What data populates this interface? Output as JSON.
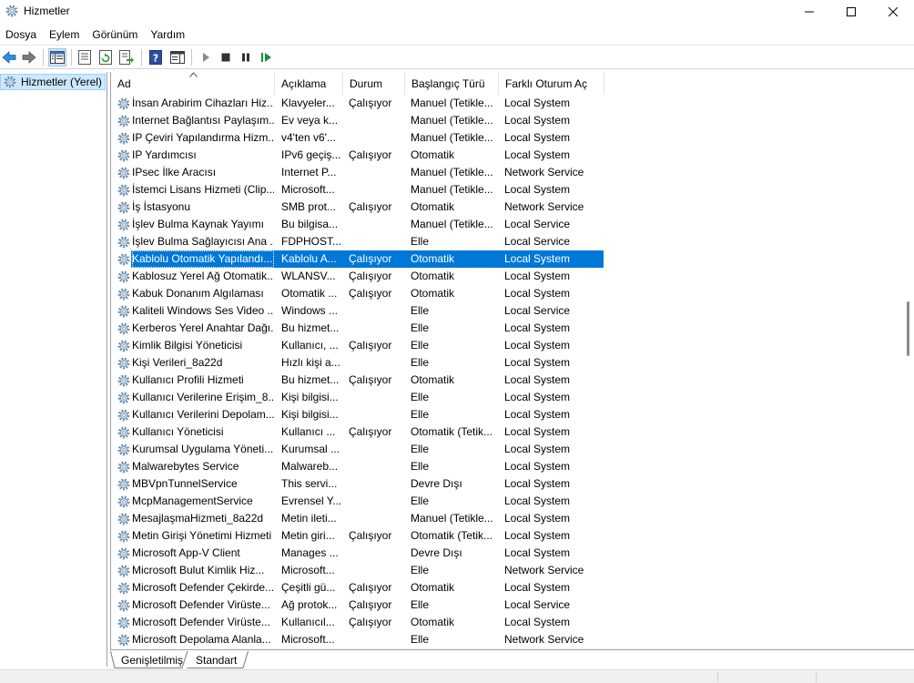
{
  "window": {
    "title": "Hizmetler"
  },
  "menu": [
    "Dosya",
    "Eylem",
    "Görünüm",
    "Yardım"
  ],
  "tree": {
    "root_label": "Hizmetler (Yerel)"
  },
  "columns": [
    "Ad",
    "Açıklama",
    "Durum",
    "Başlangıç Türü",
    "Farklı Oturum Aç"
  ],
  "services": [
    {
      "name": "İnsan Arabirim Cihazları Hiz...",
      "desc": "Klavyeler...",
      "status": "Çalışıyor",
      "startup": "Manuel (Tetikle...",
      "logon": "Local System"
    },
    {
      "name": "Internet Bağlantısı Paylaşım...",
      "desc": "Ev veya k...",
      "status": "",
      "startup": "Manuel (Tetikle...",
      "logon": "Local System"
    },
    {
      "name": "IP Çeviri Yapılandırma Hizm...",
      "desc": "v4'ten v6'...",
      "status": "",
      "startup": "Manuel (Tetikle...",
      "logon": "Local System"
    },
    {
      "name": "IP Yardımcısı",
      "desc": "IPv6 geçiş...",
      "status": "Çalışıyor",
      "startup": "Otomatik",
      "logon": "Local System"
    },
    {
      "name": "IPsec İlke Aracısı",
      "desc": "Internet P...",
      "status": "",
      "startup": "Manuel (Tetikle...",
      "logon": "Network Service"
    },
    {
      "name": "İstemci Lisans Hizmeti (Clip...",
      "desc": "Microsoft...",
      "status": "",
      "startup": "Manuel (Tetikle...",
      "logon": "Local System"
    },
    {
      "name": "İş İstasyonu",
      "desc": "SMB prot...",
      "status": "Çalışıyor",
      "startup": "Otomatik",
      "logon": "Network Service"
    },
    {
      "name": "İşlev Bulma Kaynak Yayımı",
      "desc": "Bu bilgisa...",
      "status": "",
      "startup": "Manuel (Tetikle...",
      "logon": "Local Service"
    },
    {
      "name": "İşlev Bulma Sağlayıcısı Ana ...",
      "desc": "FDPHOST...",
      "status": "",
      "startup": "Elle",
      "logon": "Local Service"
    },
    {
      "name": "Kablolu Otomatik Yapılandı...",
      "desc": "Kablolu A...",
      "status": "Çalışıyor",
      "startup": "Otomatik",
      "logon": "Local System",
      "selected": true
    },
    {
      "name": "Kablosuz Yerel Ağ Otomatik...",
      "desc": "WLANSV...",
      "status": "Çalışıyor",
      "startup": "Otomatik",
      "logon": "Local System"
    },
    {
      "name": "Kabuk Donanım Algılaması",
      "desc": "Otomatik ...",
      "status": "Çalışıyor",
      "startup": "Otomatik",
      "logon": "Local System"
    },
    {
      "name": "Kaliteli Windows Ses Video ...",
      "desc": "Windows ...",
      "status": "",
      "startup": "Elle",
      "logon": "Local Service"
    },
    {
      "name": "Kerberos Yerel Anahtar Dağı...",
      "desc": "Bu hizmet...",
      "status": "",
      "startup": "Elle",
      "logon": "Local System"
    },
    {
      "name": "Kimlik Bilgisi Yöneticisi",
      "desc": "Kullanıcı, ...",
      "status": "Çalışıyor",
      "startup": "Elle",
      "logon": "Local System"
    },
    {
      "name": "Kişi Verileri_8a22d",
      "desc": "Hızlı kişi a...",
      "status": "",
      "startup": "Elle",
      "logon": "Local System"
    },
    {
      "name": "Kullanıcı Profili Hizmeti",
      "desc": "Bu hizmet...",
      "status": "Çalışıyor",
      "startup": "Otomatik",
      "logon": "Local System"
    },
    {
      "name": "Kullanıcı Verilerine Erişim_8...",
      "desc": "Kişi bilgisi...",
      "status": "",
      "startup": "Elle",
      "logon": "Local System"
    },
    {
      "name": "Kullanıcı Verilerini Depolam...",
      "desc": "Kişi bilgisi...",
      "status": "",
      "startup": "Elle",
      "logon": "Local System"
    },
    {
      "name": "Kullanıcı Yöneticisi",
      "desc": "Kullanıcı ...",
      "status": "Çalışıyor",
      "startup": "Otomatik (Tetik...",
      "logon": "Local System"
    },
    {
      "name": "Kurumsal Uygulama Yöneti...",
      "desc": "Kurumsal ...",
      "status": "",
      "startup": "Elle",
      "logon": "Local System"
    },
    {
      "name": "Malwarebytes Service",
      "desc": "Malwareb...",
      "status": "",
      "startup": "Elle",
      "logon": "Local System"
    },
    {
      "name": "MBVpnTunnelService",
      "desc": "This servi...",
      "status": "",
      "startup": "Devre Dışı",
      "logon": "Local System"
    },
    {
      "name": "McpManagementService",
      "desc": "Evrensel Y...",
      "status": "",
      "startup": "Elle",
      "logon": "Local System"
    },
    {
      "name": "MesajlaşmaHizmeti_8a22d",
      "desc": "Metin ileti...",
      "status": "",
      "startup": "Manuel (Tetikle...",
      "logon": "Local System"
    },
    {
      "name": "Metin Girişi Yönetimi Hizmeti",
      "desc": "Metin giri...",
      "status": "Çalışıyor",
      "startup": "Otomatik (Tetik...",
      "logon": "Local System"
    },
    {
      "name": "Microsoft App-V Client",
      "desc": "Manages ...",
      "status": "",
      "startup": "Devre Dışı",
      "logon": "Local System"
    },
    {
      "name": "Microsoft Bulut Kimlik Hiz...",
      "desc": "Microsoft...",
      "status": "",
      "startup": "Elle",
      "logon": "Network Service"
    },
    {
      "name": "Microsoft Defender Çekirde...",
      "desc": "Çeşitli gü...",
      "status": "Çalışıyor",
      "startup": "Otomatik",
      "logon": "Local System"
    },
    {
      "name": "Microsoft Defender Virüste...",
      "desc": "Ağ protok...",
      "status": "Çalışıyor",
      "startup": "Elle",
      "logon": "Local Service"
    },
    {
      "name": "Microsoft Defender Virüste...",
      "desc": "Kullanıcıl...",
      "status": "Çalışıyor",
      "startup": "Otomatik",
      "logon": "Local System"
    },
    {
      "name": "Microsoft Depolama Alanla...",
      "desc": "Microsoft...",
      "status": "",
      "startup": "Elle",
      "logon": "Network Service"
    }
  ],
  "tabs": [
    "Genişletilmiş",
    "Standart"
  ],
  "colors": {
    "selection": "#0078d7",
    "tree_selection": "#cde8ff"
  }
}
